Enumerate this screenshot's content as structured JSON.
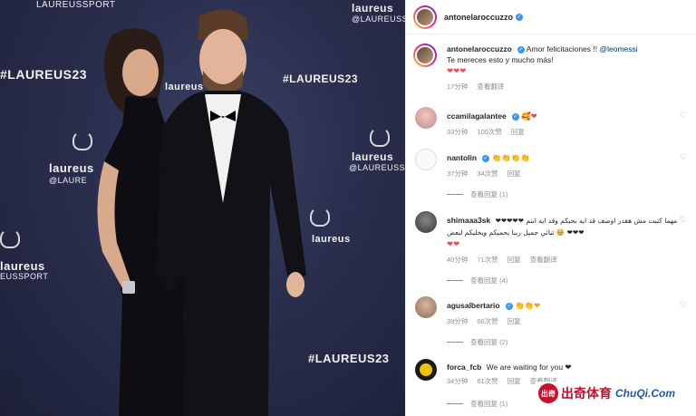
{
  "photo": {
    "wall_logos": [
      "LAUREUSSPORT",
      "laureus",
      "@LAUREUSSPORT",
      "#LAUREUS23",
      "#LAUREUS23",
      "laureus",
      "@LAUREUSSPORT",
      "laureus",
      "@LAURE",
      "laureus",
      "#LAUREUS23",
      "laureus",
      "EUSSPORT",
      "laureus"
    ]
  },
  "post_header": {
    "username": "antonelaroccuzzo"
  },
  "caption": {
    "username": "antonelaroccuzzo",
    "text": "Amor felicitaciones !!",
    "mention": "@leomessi",
    "line2": "Te mereces esto y mucho más!",
    "emojis": "❤❤❤",
    "time": "17分钟",
    "translate": "查看翻译"
  },
  "comments": [
    {
      "username": "ccamilagalantee",
      "text": "🥰❤",
      "time": "33分钟",
      "likes": "100次赞",
      "reply": "回复",
      "replies": ""
    },
    {
      "username": "nantolin",
      "text": "👏👏👏👏",
      "time": "37分钟",
      "likes": "34次赞",
      "reply": "回复",
      "replies": "查看回复 (1)"
    },
    {
      "username": "shimaaa3sk",
      "text": "مهما كتبت مش هقدر اوصف قد ايه بحبكم وقد ايه انتم ❤❤❤❤❤❤❤❤ 🥹 ثنائي جميل ربنا يحميكم ويخليكم لبعض",
      "text2": "❤❤",
      "time": "40分钟",
      "likes": "71次赞",
      "reply": "回复",
      "translate": "查看翻译",
      "replies": "查看回复 (4)"
    },
    {
      "username": "agusalbertario",
      "text": "👏👏❤",
      "time": "39分钟",
      "likes": "66次赞",
      "reply": "回复",
      "replies": "查看回复 (2)"
    },
    {
      "username": "forca_fcb",
      "text": "We are waiting for you ❤",
      "time": "34分钟",
      "likes": "61次赞",
      "reply": "回复",
      "translate": "查看翻译",
      "replies": "查看回复 (1)"
    }
  ],
  "watermark": {
    "cn": "出奇体育",
    "en": "ChuQi.Com",
    "logo": "出奇"
  },
  "colors": {
    "verified": "#3897f0",
    "heart": "#ed4956",
    "backdrop": "#2a2e4d"
  }
}
